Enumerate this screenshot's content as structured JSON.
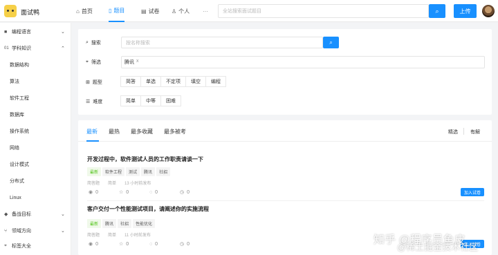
{
  "header": {
    "brand": "面试鸭",
    "nav": [
      {
        "label": "首页",
        "icon": "home-icon",
        "glyph": "⌂"
      },
      {
        "label": "题目",
        "icon": "file-icon",
        "glyph": "▯"
      },
      {
        "label": "试卷",
        "icon": "doc-icon",
        "glyph": "▤"
      },
      {
        "label": "个人",
        "icon": "user-icon",
        "glyph": "♙"
      }
    ],
    "more": "···",
    "search_placeholder": "全站搜索面试题目",
    "upload_label": "上传",
    "accent": "#1890ff"
  },
  "sidebar": {
    "items": [
      {
        "label": "编程语言",
        "icon": "■",
        "chevron": "⌄"
      },
      {
        "label": "学科知识",
        "icon": "01",
        "chevron": "⌃"
      },
      {
        "label": "数据结构"
      },
      {
        "label": "算法"
      },
      {
        "label": "软件工程"
      },
      {
        "label": "数据库"
      },
      {
        "label": "操作系统"
      },
      {
        "label": "网络"
      },
      {
        "label": "设计模式"
      },
      {
        "label": "分布式"
      },
      {
        "label": "Linux"
      },
      {
        "label": "备战目标",
        "icon": "◆",
        "chevron": "⌄"
      },
      {
        "label": "领域方向",
        "icon": "⑂",
        "chevron": "⌄"
      },
      {
        "label": "标签大全",
        "icon": "⌖"
      }
    ]
  },
  "filters": {
    "search_label": "搜索",
    "search_placeholder": "按名称搜索",
    "filter_label": "筛选",
    "filter_chip": "腾讯",
    "filter_chip_close": "x",
    "type_label": "题型",
    "types": [
      "简答",
      "单选",
      "不定项",
      "填空",
      "编程"
    ],
    "difficulty_label": "难度",
    "difficulties": [
      "简单",
      "中等",
      "困难"
    ]
  },
  "list": {
    "tabs": [
      "最新",
      "最热",
      "最多收藏",
      "最多被考"
    ],
    "sort_options": [
      "精选",
      "有解"
    ],
    "questions": [
      {
        "title": "开发过程中，软件测试人员的工作职责请谈一下",
        "tags": [
          "最新",
          "软件工程",
          "测试",
          "腾讯",
          "社招"
        ],
        "type": "简答题",
        "difficulty": "简单",
        "time": "13 小时前发布",
        "stats": [
          "0",
          "0",
          "0",
          "0"
        ],
        "action": "加入试卷"
      },
      {
        "title": "客户交付一个性能测试项目，请阐述你的实施流程",
        "tags": [
          "最新",
          "腾讯",
          "社招",
          "性能优化"
        ],
        "type": "简答题",
        "difficulty": "简单",
        "time": "11 小时前发布",
        "stats": [
          "0",
          "0",
          "0",
          "0"
        ],
        "action": "加入试卷"
      }
    ]
  },
  "watermark": {
    "line1": "知乎 @程序员鱼皮",
    "line2": "@稀土掘金技术社区"
  }
}
